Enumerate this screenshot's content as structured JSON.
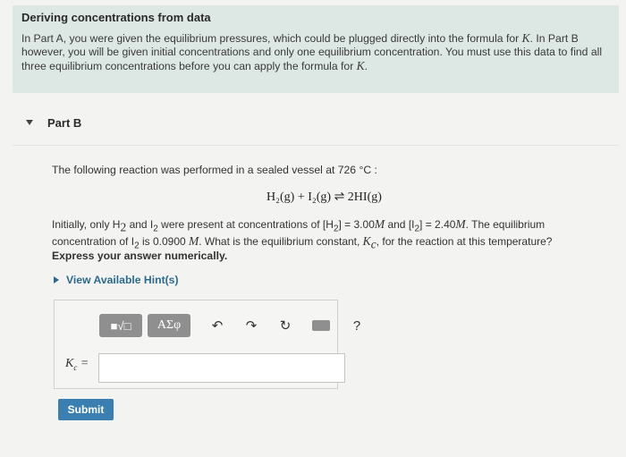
{
  "intro": {
    "title": "Deriving concentrations from data",
    "text_1": "In Part A, you were given the equilibrium pressures, which could be plugged directly into the formula for ",
    "K": "K",
    "text_2": ". In Part B however, you will be given initial concentrations and only one equilibrium concentration. You must use this data to find all three equilibrium concentrations before you can apply the formula for ",
    "text_3": "."
  },
  "part": {
    "label": "Part B"
  },
  "question": {
    "line_1": "The following reaction was performed in a sealed vessel at 726 °C :",
    "equation": "H₂(g) + I₂(g) ⇌ 2HI(g)",
    "p_1": "Initially, only H",
    "sub_2a": "2",
    "p_2": " and I",
    "sub_2b": "2",
    "p_3": " were present at concentrations of [H",
    "sub_2c": "2",
    "p_4": "] = 3.00",
    "M1": "M",
    "p_5": " and [I",
    "sub_2d": "2",
    "p_6": "] = 2.40",
    "M2": "M",
    "p_7": ". The equilibrium concentration of I",
    "sub_2e": "2",
    "p_8": " is 0.0900 ",
    "M3": "M",
    "p_9": ". What is the equilibrium constant, ",
    "Kc": "K",
    "c": "c",
    "p_10": ", for the reaction at this temperature?",
    "instruction": "Express your answer numerically.",
    "hint_link": "View Available Hint(s)"
  },
  "toolbar": {
    "template": "■√□",
    "greek": "ΑΣφ",
    "undo": "↶",
    "redo": "↷",
    "reset": "↻",
    "help": "?"
  },
  "answer": {
    "label_K": "K",
    "label_c": "c",
    "label_eq": " =",
    "value": ""
  },
  "submit_label": "Submit"
}
